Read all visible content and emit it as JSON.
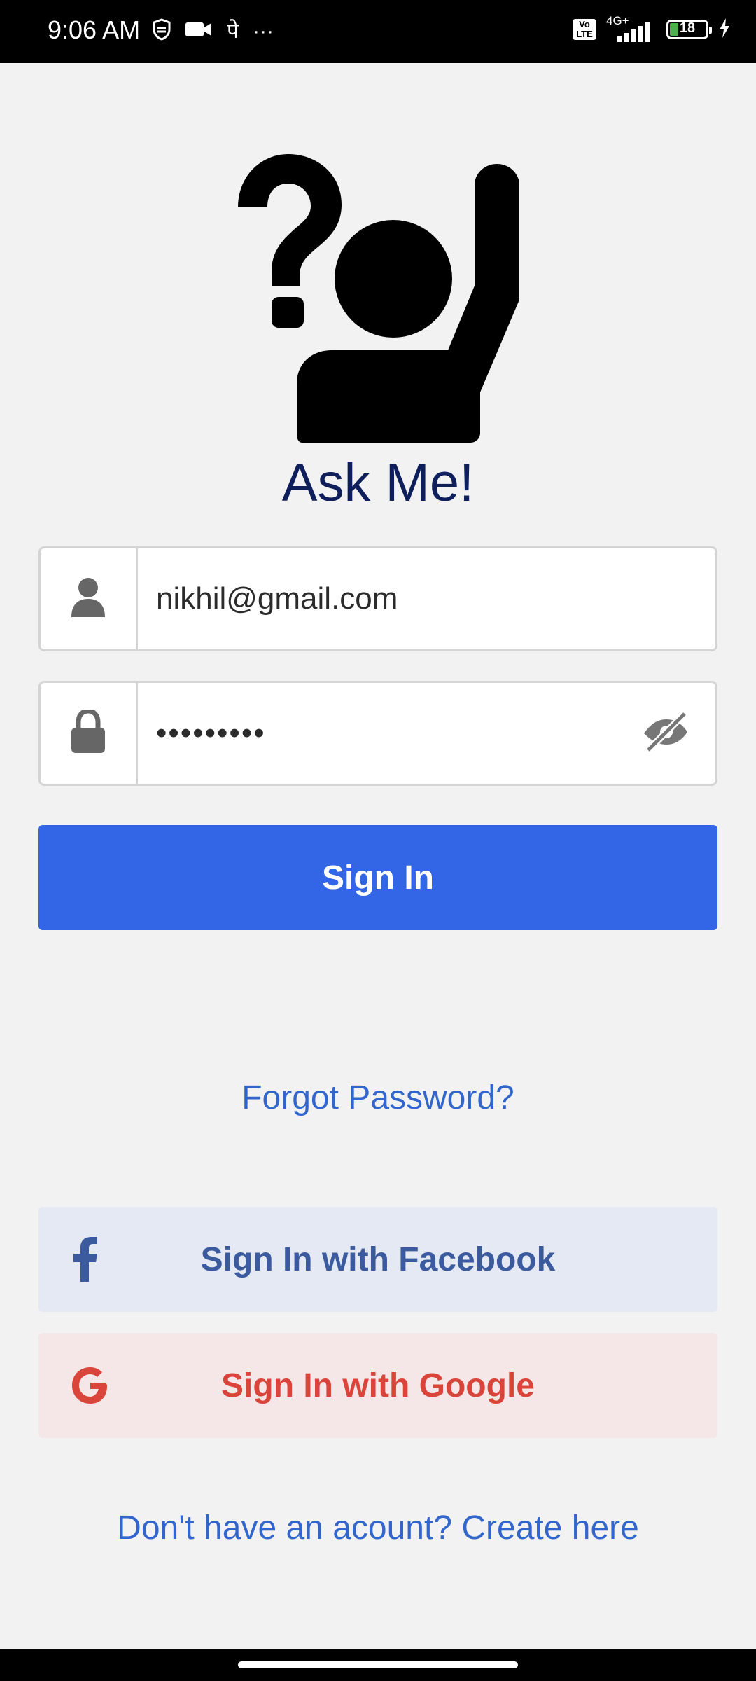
{
  "status_bar": {
    "time": "9:06 AM",
    "left_icons": [
      "shield-icon",
      "video-icon",
      "pe-icon",
      "more-icon"
    ],
    "pe_glyph": "पे",
    "more_glyph": "···",
    "volte_label": "Vo LTE",
    "network": "4G+",
    "battery": "18"
  },
  "app": {
    "title": "Ask Me!",
    "logo": "person-question-icon"
  },
  "login_form": {
    "email_value": "nikhil@gmail.com",
    "password_value": "•••••••••",
    "sign_in_label": "Sign In",
    "forgot_password_label": "Forgot Password?"
  },
  "social": {
    "facebook_label": "Sign In with Facebook",
    "google_label": "Sign In with Google"
  },
  "footer": {
    "create_account_label": "Don't have an acount? Create here"
  },
  "colors": {
    "primary": "#3366e6",
    "title": "#0f1f5c",
    "link": "#3366cc",
    "facebook": "#3c5a9e",
    "google": "#d9453a"
  }
}
